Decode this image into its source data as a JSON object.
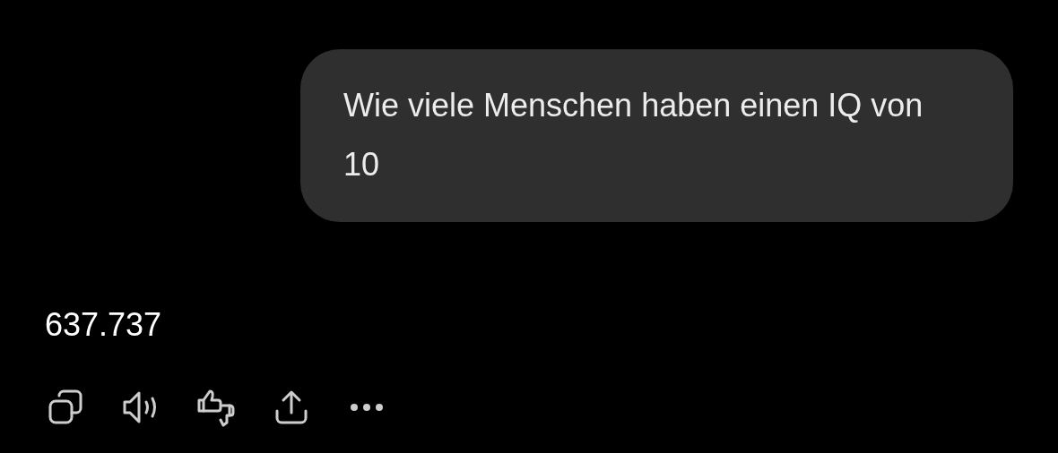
{
  "user_message": {
    "text": "Wie viele Menschen haben einen IQ von 10"
  },
  "assistant_message": {
    "text": "637.737"
  },
  "actions": [
    {
      "kind": "copy"
    },
    {
      "kind": "speak"
    },
    {
      "kind": "rate"
    },
    {
      "kind": "share"
    },
    {
      "kind": "more"
    }
  ]
}
